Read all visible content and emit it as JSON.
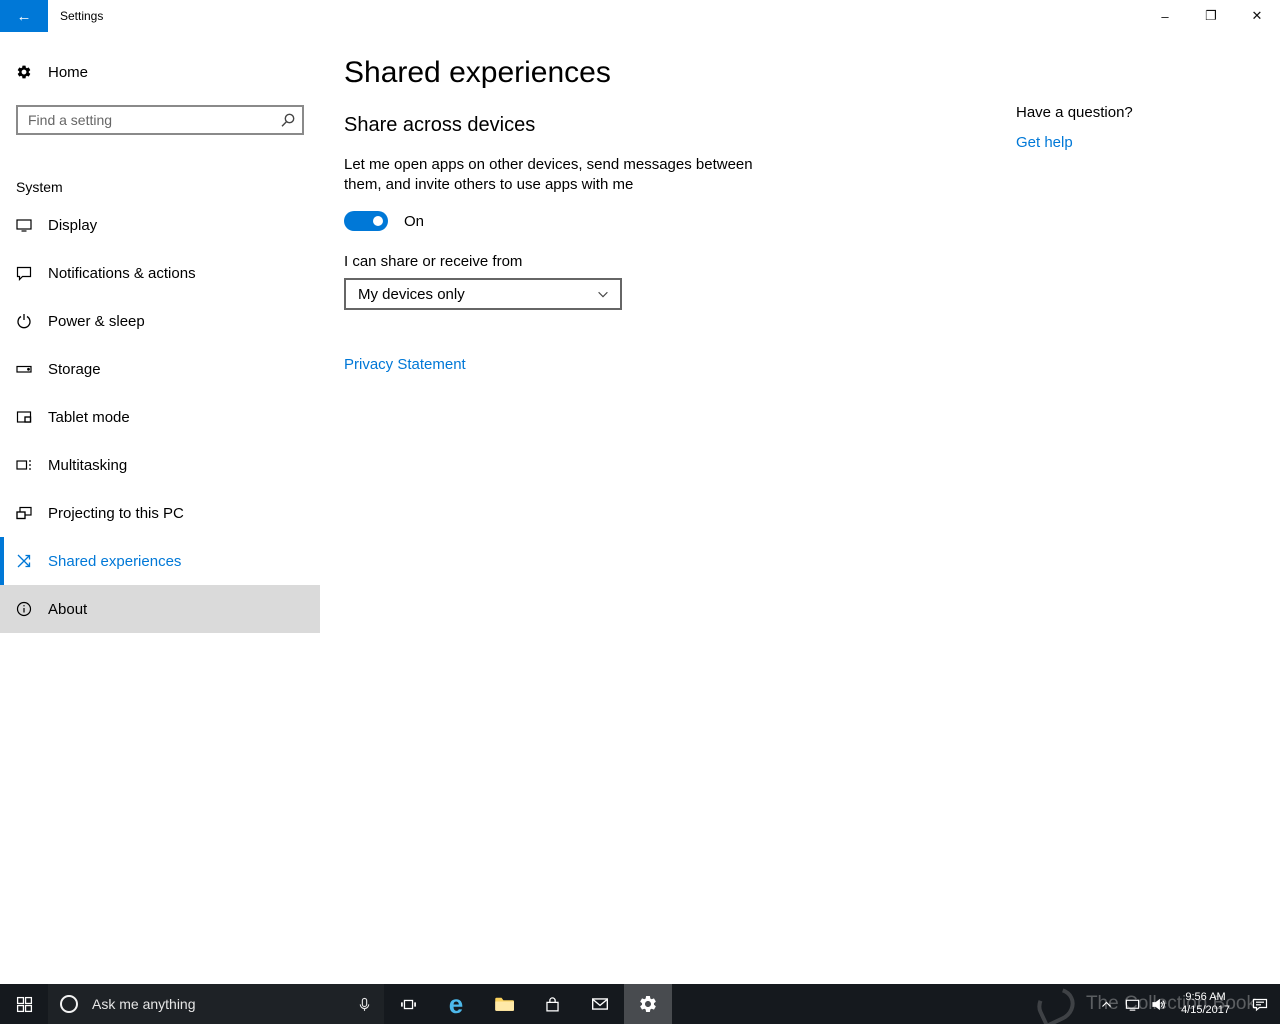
{
  "colors": {
    "accent": "#0078d7",
    "taskbar": "#15191e"
  },
  "titlebar": {
    "title": "Settings",
    "back_glyph": "←",
    "minimize_glyph": "–",
    "maximize_glyph": "❐",
    "close_glyph": "✕"
  },
  "sidebar": {
    "home_label": "Home",
    "search_placeholder": "Find a setting",
    "section_label": "System",
    "items": [
      {
        "label": "Display"
      },
      {
        "label": "Notifications & actions"
      },
      {
        "label": "Power & sleep"
      },
      {
        "label": "Storage"
      },
      {
        "label": "Tablet mode"
      },
      {
        "label": "Multitasking"
      },
      {
        "label": "Projecting to this PC"
      },
      {
        "label": "Shared experiences",
        "selected": true
      },
      {
        "label": "About",
        "hovered": true
      }
    ]
  },
  "main": {
    "title": "Shared experiences",
    "section_title": "Share across devices",
    "description": "Let me open apps on other devices, send messages between them, and invite others to use apps with me",
    "toggle_state": "On",
    "share_field_label": "I can share or receive from",
    "dropdown_value": "My devices only",
    "privacy_link": "Privacy Statement"
  },
  "help": {
    "question": "Have a question?",
    "link": "Get help"
  },
  "taskbar": {
    "search_placeholder": "Ask me anything",
    "edge_glyph": "e",
    "clock": {
      "time": "9:56 AM",
      "date": "4/15/2017"
    },
    "watermark": "The Collection Book"
  }
}
